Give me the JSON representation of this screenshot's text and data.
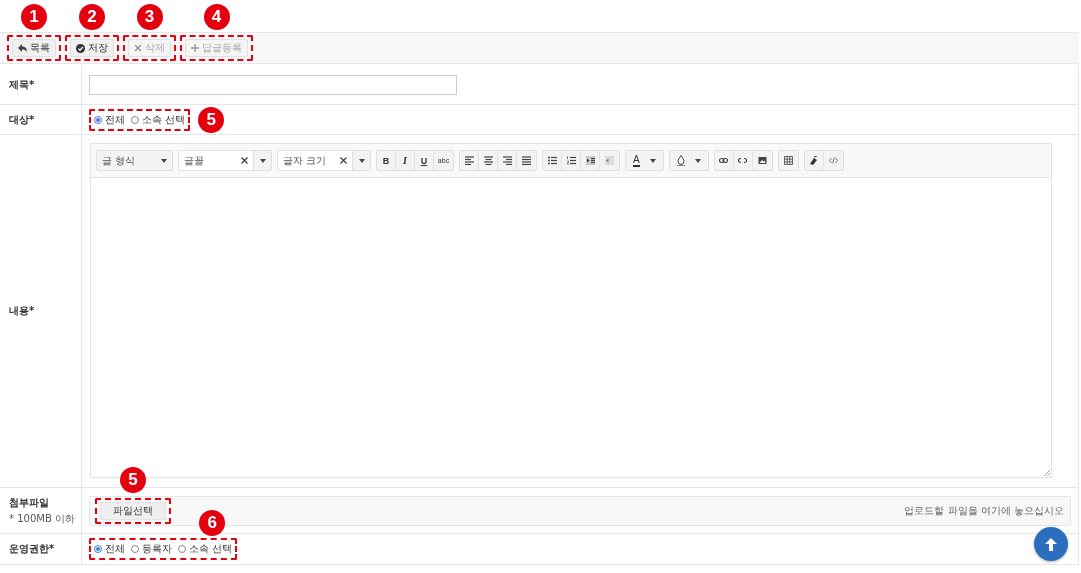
{
  "toolbar": {
    "buttons": [
      {
        "kind": "back",
        "label": "목록",
        "disabled": false,
        "callout": "1"
      },
      {
        "kind": "save",
        "label": "저장",
        "disabled": false,
        "callout": "2"
      },
      {
        "kind": "delete",
        "label": "삭제",
        "disabled": true,
        "callout": "3"
      },
      {
        "kind": "reply",
        "label": "답글등록",
        "disabled": true,
        "callout": "4"
      }
    ]
  },
  "form": {
    "title_row": {
      "label": "제목*"
    },
    "target_row": {
      "label": "대상*",
      "callout": "5",
      "options": [
        {
          "label": "전체",
          "selected": true
        },
        {
          "label": "소속 선택",
          "selected": false
        }
      ]
    },
    "content_row": {
      "label": "내용*",
      "editor": {
        "format_select": "글 형식",
        "font_select": "글꼴",
        "size_select": "글자 크기",
        "style_buttons": [
          "B",
          "I",
          "U",
          "abc"
        ],
        "text_color": "A"
      }
    },
    "attach_row": {
      "label": "첨부파일",
      "note": "* 100MB 이하",
      "button": "파일선택",
      "callout": "5",
      "drop_hint": "업로드할 파일을 여기에 놓으십시오"
    },
    "permission_row": {
      "label": "운영권한*",
      "callout": "6",
      "options": [
        {
          "label": "전체",
          "selected": true
        },
        {
          "label": "등록자",
          "selected": false
        },
        {
          "label": "소속 선택",
          "selected": false
        }
      ]
    }
  }
}
